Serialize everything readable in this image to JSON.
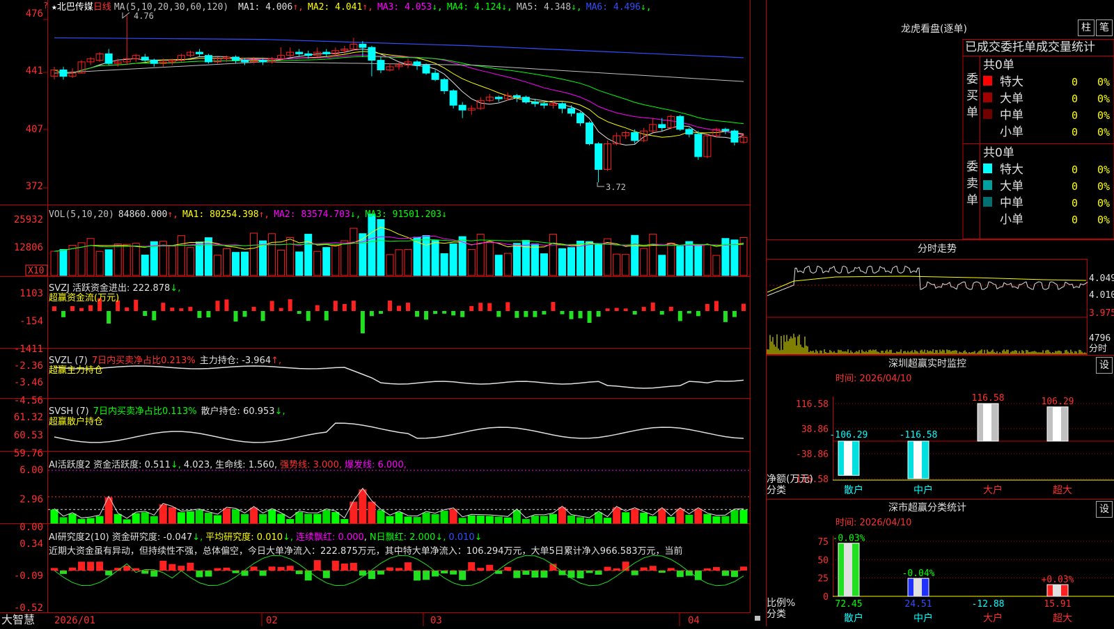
{
  "stock": {
    "name": "北巴传媒",
    "period": "日线",
    "star": "★",
    "help": "?"
  },
  "price": {
    "ma_label": "MA(5,10,20,30,60,120)",
    "ma_items": [
      {
        "label": "MA1: 4.006",
        "color": "#e0e0e0"
      },
      {
        "label": "MA2: 4.041",
        "color": "#ffff00"
      },
      {
        "label": "MA3: 4.053",
        "color": "#ff00ff"
      },
      {
        "label": "MA4: 4.124",
        "color": "#00ff00"
      },
      {
        "label": "MA5: 4.348",
        "color": "#c0c0c0"
      },
      {
        "label": "MA6: 4.496",
        "color": "#3050ff"
      }
    ],
    "axis": [
      "476",
      "441",
      "407",
      "372"
    ],
    "high_mark": "4.76",
    "low_mark": "3.72"
  },
  "volume": {
    "label": "VOL(5,10,20)",
    "value": "84860.000",
    "ma1": "MA1: 80254.398",
    "ma2": "MA2: 83574.703",
    "ma3": "MA3: 91501.203",
    "axis": [
      "25932",
      "12806"
    ],
    "unit": "X10"
  },
  "svzj": {
    "label": "SVZJ  活跃资金进出: 222.878",
    "sub": "超赢资金流(万元)",
    "axis": [
      "1103",
      "-154",
      "-1411"
    ]
  },
  "svzl": {
    "label": "SVZL (7)",
    "ratio": "7日内买卖净占比0.213%",
    "hold": "主力持仓: -3.964",
    "sub": "超赢主力持仓",
    "axis": [
      "-2.36",
      "-3.46",
      "-4.56"
    ]
  },
  "svsh": {
    "label": "SVSH (7)",
    "ratio": "7日内买卖净占比0.113%",
    "hold": "散户持仓: 60.953",
    "sub": "超赢散户持仓",
    "axis": [
      "61.32",
      "60.53",
      "59.76"
    ]
  },
  "ai_active": {
    "label": "AI活跃度2 资金活跃度: 0.511",
    "v2": "4.023",
    "life": "生命线: 1.560,",
    "strong": "强势线: 3.000,",
    "burst": "爆发线: 6.000,",
    "axis": [
      "6.00",
      "2.96",
      "0.00"
    ]
  },
  "ai_research": {
    "label": "AI研究度2(10) 资金研究度: -0.047",
    "avg": "平均研究度: 0.010",
    "red": "连续飘红: 0.000",
    "nred": "N日飘红: 2.000",
    "last": "0.010",
    "text": "近期大资金虽有异动，但持续性不强，总体偏空，今日大单净流入：222.875万元，其中特大单净流入：106.294万元，大单5日累计净入966.583万元，当前",
    "axis": [
      "0.34",
      "-0.09",
      "-0.52"
    ]
  },
  "xaxis": [
    "2026/01",
    "02",
    "03",
    "04"
  ],
  "brand": "大智慧",
  "lhb": {
    "title": "龙虎看盘(逐单)",
    "btn1": "柱",
    "btn2": "笔",
    "tabs": "已成交委托单成交量统计",
    "buy": {
      "label": "委买单",
      "total": "共0单",
      "rows": [
        {
          "name": "特大",
          "count": "0",
          "pct": "0%",
          "color": "#ff0000"
        },
        {
          "name": "大单",
          "count": "0",
          "pct": "0%",
          "color": "#a00000"
        },
        {
          "name": "中单",
          "count": "0",
          "pct": "0%",
          "color": "#700000"
        },
        {
          "name": "小单",
          "count": "0",
          "pct": "0%",
          "color": "#000000"
        }
      ]
    },
    "sell": {
      "label": "委卖单",
      "total": "共0单",
      "rows": [
        {
          "name": "特大",
          "count": "0",
          "pct": "0%",
          "color": "#00ffff"
        },
        {
          "name": "大单",
          "count": "0",
          "pct": "0%",
          "color": "#00a0a0"
        },
        {
          "name": "中单",
          "count": "0",
          "pct": "0%",
          "color": "#007070"
        },
        {
          "name": "小单",
          "count": "0",
          "pct": "0%",
          "color": "#000000"
        }
      ]
    }
  },
  "intraday": {
    "title": "分时走势",
    "axis": [
      "4.049",
      "4.010",
      "3.975"
    ],
    "vol": "4796",
    "unit": "分时"
  },
  "sz_monitor": {
    "title": "深圳超赢实时监控",
    "btn": "设",
    "time": "时间: 2026/04/10",
    "axis": [
      "116.58",
      "38.86",
      "-38.86",
      "-116.58"
    ],
    "ylabel": "净额(万元)",
    "xlabel": "分类",
    "bars": [
      {
        "name": "散户",
        "value": -106.29,
        "label": "-106.29"
      },
      {
        "name": "中户",
        "value": -116.58,
        "label": "-116.58"
      },
      {
        "name": "大户",
        "value": 116.58,
        "label": "116.58"
      },
      {
        "name": "超大",
        "value": 106.29,
        "label": "106.29"
      }
    ]
  },
  "sz_class": {
    "title": "深市超赢分类统计",
    "btn": "设",
    "time": "时间: 2026/04/10",
    "axis": [
      "75",
      "50",
      "25",
      "0"
    ],
    "ylabel": "比例%",
    "xlabel": "分类",
    "bars": [
      {
        "name": "散户",
        "value": 72.45,
        "label": "72.45",
        "delta": "-0.03%"
      },
      {
        "name": "中户",
        "value": 24.51,
        "label": "24.51",
        "delta": "-0.04%"
      },
      {
        "name": "大户",
        "value": -12.88,
        "label": "-12.88",
        "delta": ""
      },
      {
        "name": "超大",
        "value": 15.91,
        "label": "15.91",
        "delta": "+0.03%"
      }
    ]
  },
  "colors": {
    "up": "#ff2020",
    "down": "#00ffff",
    "grid": "#b00000",
    "axis_text": "#ff3030"
  },
  "chart_data": {
    "type": "candlestick",
    "x": [
      "2026/01",
      "02",
      "03",
      "04"
    ],
    "price_range": [
      3.72,
      4.76
    ],
    "candles": [
      [
        4.38,
        4.42,
        4.36,
        4.44
      ],
      [
        4.42,
        4.38,
        4.36,
        4.44
      ],
      [
        4.38,
        4.4,
        4.37,
        4.43
      ],
      [
        4.4,
        4.47,
        4.4,
        4.48
      ],
      [
        4.47,
        4.49,
        4.45,
        4.5
      ],
      [
        4.48,
        4.52,
        4.47,
        4.53
      ],
      [
        4.52,
        4.46,
        4.45,
        4.55
      ],
      [
        4.46,
        4.47,
        4.44,
        4.49
      ],
      [
        4.47,
        4.49,
        4.45,
        4.76
      ],
      [
        4.49,
        4.51,
        4.47,
        4.52
      ],
      [
        4.5,
        4.48,
        4.47,
        4.52
      ],
      [
        4.48,
        4.46,
        4.44,
        4.49
      ],
      [
        4.46,
        4.47,
        4.44,
        4.49
      ],
      [
        4.47,
        4.48,
        4.45,
        4.49
      ],
      [
        4.48,
        4.51,
        4.47,
        4.52
      ],
      [
        4.51,
        4.53,
        4.5,
        4.54
      ],
      [
        4.53,
        4.52,
        4.5,
        4.55
      ],
      [
        4.51,
        4.47,
        4.46,
        4.52
      ],
      [
        4.47,
        4.49,
        4.46,
        4.5
      ],
      [
        4.49,
        4.5,
        4.47,
        4.51
      ],
      [
        4.5,
        4.48,
        4.46,
        4.51
      ],
      [
        4.48,
        4.47,
        4.45,
        4.49
      ],
      [
        4.47,
        4.48,
        4.46,
        4.5
      ],
      [
        4.48,
        4.47,
        4.45,
        4.49
      ],
      [
        4.47,
        4.49,
        4.46,
        4.5
      ],
      [
        4.49,
        4.51,
        4.48,
        4.56
      ],
      [
        4.51,
        4.53,
        4.5,
        4.56
      ],
      [
        4.53,
        4.52,
        4.5,
        4.55
      ],
      [
        4.52,
        4.51,
        4.49,
        4.54
      ],
      [
        4.51,
        4.53,
        4.5,
        4.56
      ],
      [
        4.53,
        4.52,
        4.5,
        4.55
      ],
      [
        4.52,
        4.54,
        4.51,
        4.56
      ],
      [
        4.54,
        4.55,
        4.52,
        4.57
      ],
      [
        4.55,
        4.58,
        4.54,
        4.62
      ],
      [
        4.58,
        4.56,
        4.5,
        4.6
      ],
      [
        4.56,
        4.48,
        4.38,
        4.57
      ],
      [
        4.48,
        4.42,
        4.4,
        4.5
      ],
      [
        4.42,
        4.44,
        4.41,
        4.46
      ],
      [
        4.44,
        4.45,
        4.42,
        4.47
      ],
      [
        4.45,
        4.47,
        4.43,
        4.49
      ],
      [
        4.47,
        4.45,
        4.42,
        4.48
      ],
      [
        4.45,
        4.4,
        4.39,
        4.46
      ],
      [
        4.4,
        4.36,
        4.35,
        4.42
      ],
      [
        4.36,
        4.29,
        4.27,
        4.37
      ],
      [
        4.29,
        4.2,
        4.18,
        4.3
      ],
      [
        4.2,
        4.17,
        4.12,
        4.22
      ],
      [
        4.17,
        4.18,
        4.14,
        4.2
      ],
      [
        4.18,
        4.23,
        4.17,
        4.25
      ],
      [
        4.23,
        4.25,
        4.22,
        4.27
      ],
      [
        4.25,
        4.24,
        4.22,
        4.26
      ],
      [
        4.24,
        4.26,
        4.23,
        4.28
      ],
      [
        4.26,
        4.25,
        4.22,
        4.27
      ],
      [
        4.25,
        4.22,
        4.21,
        4.26
      ],
      [
        4.22,
        4.21,
        4.19,
        4.24
      ],
      [
        4.21,
        4.2,
        4.18,
        4.22
      ],
      [
        4.2,
        4.21,
        4.18,
        4.23
      ],
      [
        4.21,
        4.18,
        4.15,
        4.22
      ],
      [
        4.18,
        4.15,
        4.13,
        4.2
      ],
      [
        4.15,
        4.09,
        4.07,
        4.16
      ],
      [
        4.09,
        3.96,
        3.95,
        4.1
      ],
      [
        3.96,
        3.8,
        3.72,
        3.97
      ],
      [
        3.8,
        3.96,
        3.79,
        3.98
      ],
      [
        3.96,
        4.01,
        3.95,
        4.03
      ],
      [
        4.01,
        4.03,
        3.99,
        4.04
      ],
      [
        4.03,
        3.98,
        3.96,
        4.05
      ],
      [
        3.98,
        4.04,
        3.97,
        4.06
      ],
      [
        4.04,
        4.08,
        4.03,
        4.12
      ],
      [
        4.08,
        4.06,
        4.04,
        4.12
      ],
      [
        4.06,
        4.13,
        4.05,
        4.14
      ],
      [
        4.13,
        4.05,
        4.04,
        4.14
      ],
      [
        4.05,
        4.02,
        4.0,
        4.06
      ],
      [
        4.02,
        3.88,
        3.86,
        4.04
      ],
      [
        3.88,
        4.01,
        3.87,
        4.02
      ],
      [
        4.01,
        4.05,
        4.0,
        4.06
      ],
      [
        4.05,
        4.04,
        4.02,
        4.06
      ],
      [
        4.04,
        3.97,
        3.95,
        4.05
      ],
      [
        3.97,
        4.0,
        3.96,
        4.02
      ]
    ]
  }
}
